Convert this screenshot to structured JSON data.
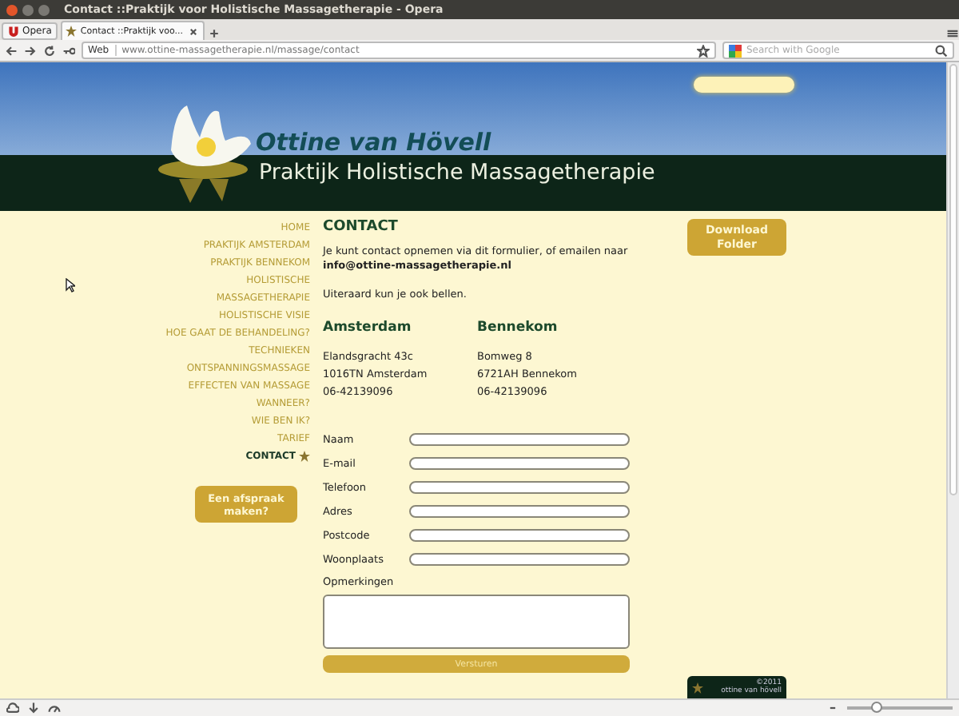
{
  "window": {
    "title": "Contact ::Praktijk voor Holistische Massagetherapie - Opera"
  },
  "menu_button": {
    "label": "Opera"
  },
  "tabs": [
    {
      "label": "Contact ::Praktijk voo...",
      "selected": true
    }
  ],
  "address_bar": {
    "badge": "Web",
    "url": "www.ottine-massagetherapie.nl/massage/contact",
    "search_placeholder": "Search with Google"
  },
  "site": {
    "name": "Ottine van Hövell",
    "tagline": "Praktijk Holistische Massagetherapie"
  },
  "nav": [
    {
      "label": "HOME",
      "selected": false
    },
    {
      "label": "PRAKTIJK AMSTERDAM",
      "selected": false
    },
    {
      "label": "PRAKTIJK BENNEKOM",
      "selected": false
    },
    {
      "label": "HOLISTISCHE MASSAGETHERAPIE",
      "selected": false
    },
    {
      "label": "HOLISTISCHE VISIE",
      "selected": false
    },
    {
      "label": "HOE GAAT DE BEHANDELING?",
      "selected": false
    },
    {
      "label": "TECHNIEKEN",
      "selected": false
    },
    {
      "label": "ONTSPANNINGSMASSAGE",
      "selected": false
    },
    {
      "label": "EFFECTEN VAN MASSAGE",
      "selected": false
    },
    {
      "label": "WANNEER?",
      "selected": false
    },
    {
      "label": "WIE BEN IK?",
      "selected": false
    },
    {
      "label": "TARIEF",
      "selected": false
    },
    {
      "label": "CONTACT",
      "selected": true
    }
  ],
  "appointment_button": "Een afspraak maken?",
  "content": {
    "heading": "CONTACT",
    "intro": "Je kunt contact opnemen via dit formulier, of emailen naar",
    "email": "info@ottine-massagetherapie.nl",
    "note": "Uiteraard kun je ook bellen.",
    "locations": [
      {
        "name": "Amsterdam",
        "lines": [
          "Elandsgracht 43c",
          "1016TN Amsterdam",
          "06-42139096"
        ]
      },
      {
        "name": "Bennekom",
        "lines": [
          "Bomweg 8",
          "6721AH Bennekom",
          "06-42139096"
        ]
      }
    ]
  },
  "form": {
    "fields": [
      {
        "label": "Naam"
      },
      {
        "label": "E-mail"
      },
      {
        "label": "Telefoon"
      },
      {
        "label": "Adres"
      },
      {
        "label": "Postcode"
      },
      {
        "label": "Woonplaats"
      }
    ],
    "remarks_label": "Opmerkingen",
    "submit": "Versturen"
  },
  "download_button": "Download Folder",
  "footer": {
    "copyright": "©2011",
    "name": "ottine van hövell"
  },
  "status_bar": {
    "zoom": {
      "level": 0.27
    }
  }
}
